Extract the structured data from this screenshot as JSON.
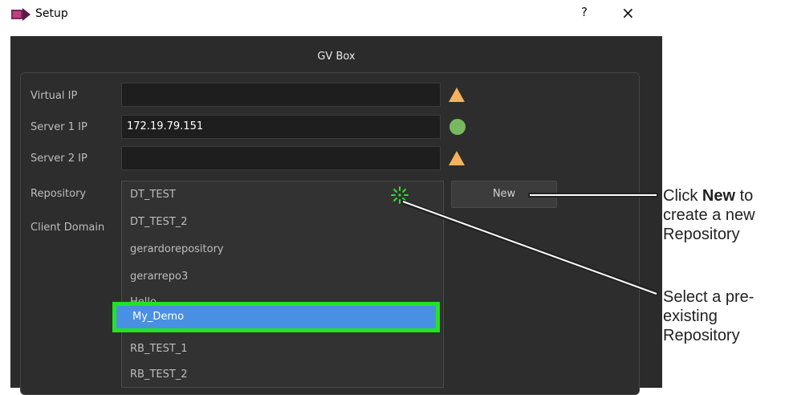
{
  "window": {
    "title": "Setup",
    "help_label": "?",
    "close_label": "×"
  },
  "group": {
    "title": "GV Box"
  },
  "fields": {
    "virtual_ip_label": "Virtual IP",
    "virtual_ip_value": "",
    "server1_label": "Server 1 IP",
    "server1_value": "172.19.79.151",
    "server2_label": "Server 2 IP",
    "server2_value": "",
    "repository_label": "Repository",
    "client_domain_label": "Client Domain"
  },
  "status": {
    "virtual_ip": "warning",
    "server1": "ok",
    "server2": "warning",
    "warning_color": "#f5b25a",
    "ok_color": "#77b860"
  },
  "buttons": {
    "new_label": "New"
  },
  "repository_list": {
    "items": [
      "DT_TEST",
      "DT_TEST_2",
      "gerardorepository",
      "gerarrepo3",
      "Hello",
      "My_Demo",
      "RB_TEST_1",
      "RB_TEST_2"
    ],
    "selected": "My_Demo",
    "highlight_color": "#21e321",
    "selection_color": "#4a90e2"
  },
  "annotations": {
    "new_line1_prefix": "Click ",
    "new_line1_bold": "New",
    "new_line1_suffix": " to",
    "new_line2": "create a new",
    "new_line3": "Repository",
    "select_line1": "Select a pre-",
    "select_line2": "existing",
    "select_line3": "Repository"
  }
}
